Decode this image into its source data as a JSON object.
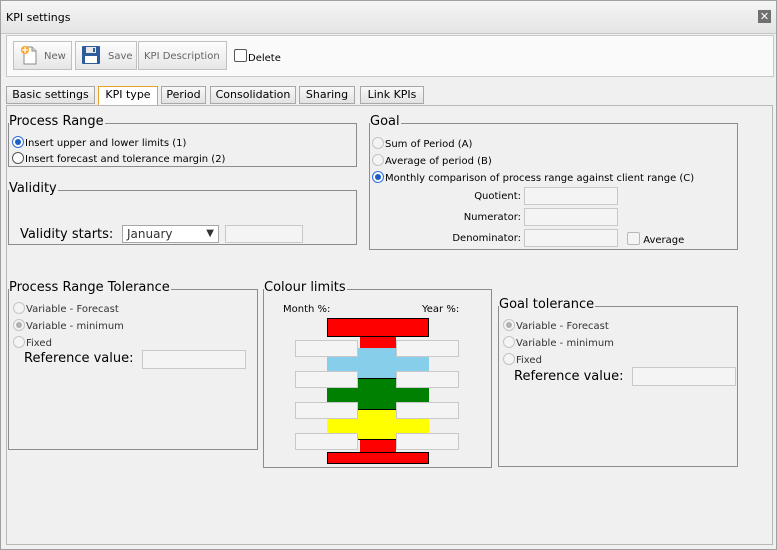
{
  "window": {
    "title": "KPI settings"
  },
  "toolbar": {
    "new_label": "New",
    "save_label": "Save",
    "kpi_description_label": "KPI Description",
    "delete_label": "Delete"
  },
  "tabs": [
    {
      "label": "Basic settings"
    },
    {
      "label": "KPI type"
    },
    {
      "label": "Period"
    },
    {
      "label": "Consolidation"
    },
    {
      "label": "Sharing"
    },
    {
      "label": "Link KPIs"
    }
  ],
  "process_range": {
    "title": "Process Range",
    "options": [
      {
        "label": "Insert upper and lower limits (1)",
        "checked": true
      },
      {
        "label": "Insert forecast and tolerance margin (2)",
        "checked": false
      }
    ]
  },
  "validity": {
    "title": "Validity",
    "starts_label": "Validity starts:",
    "month_value": "January"
  },
  "goal": {
    "title": "Goal",
    "options": [
      {
        "label": "Sum of Period (A)",
        "checked": false
      },
      {
        "label": "Average of period (B)",
        "checked": false
      },
      {
        "label": "Monthly comparison of process range against client range (C)",
        "checked": true
      }
    ],
    "quotient_label": "Quotient:",
    "numerator_label": "Numerator:",
    "denominator_label": "Denominator:",
    "average_label": "Average"
  },
  "process_range_tolerance": {
    "title": "Process Range Tolerance",
    "options": [
      {
        "label": "Variable - Forecast",
        "checked": false
      },
      {
        "label": "Variable - minimum",
        "checked": true
      },
      {
        "label": "Fixed",
        "checked": false
      }
    ],
    "reference_label": "Reference value:"
  },
  "colour_limits": {
    "title": "Colour limits",
    "month_label": "Month %:",
    "year_label": "Year %:",
    "colors": {
      "red": "#ff0000",
      "blue": "#87ceeb",
      "green": "#008000",
      "yellow": "#ffff00"
    }
  },
  "goal_tolerance": {
    "title": "Goal tolerance",
    "options": [
      {
        "label": "Variable - Forecast",
        "checked": true
      },
      {
        "label": "Variable - minimum",
        "checked": false
      },
      {
        "label": "Fixed",
        "checked": false
      }
    ],
    "reference_label": "Reference value:"
  }
}
